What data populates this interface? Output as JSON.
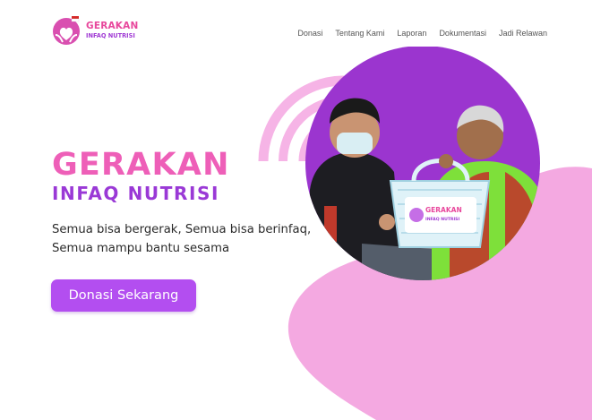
{
  "brand": {
    "name_line1": "GERAKAN",
    "name_line2": "INFAQ NUTRISI",
    "primary_pink": "#ee5fb8",
    "primary_purple": "#9a39d6",
    "button_purple": "#b34ef0",
    "blob_pink": "#f4a9e1"
  },
  "nav": {
    "items": [
      {
        "label": "Donasi"
      },
      {
        "label": "Tentang Kami"
      },
      {
        "label": "Laporan"
      },
      {
        "label": "Dokumentasi"
      },
      {
        "label": "Jadi Relawan"
      }
    ]
  },
  "hero": {
    "title": "GERAKAN",
    "subtitle": "INFAQ NUTRISI",
    "description": "Semua bisa bergerak, Semua bisa berinfaq, Semua mampu bantu sesama",
    "cta_label": "Donasi Sekarang",
    "basket_label_line1": "GERAKAN",
    "basket_label_line2": "INFAQ NUTRISI"
  },
  "icons": {
    "logo": "hands-heart-logo-icon",
    "arcs": "signal-arcs-decoration"
  }
}
